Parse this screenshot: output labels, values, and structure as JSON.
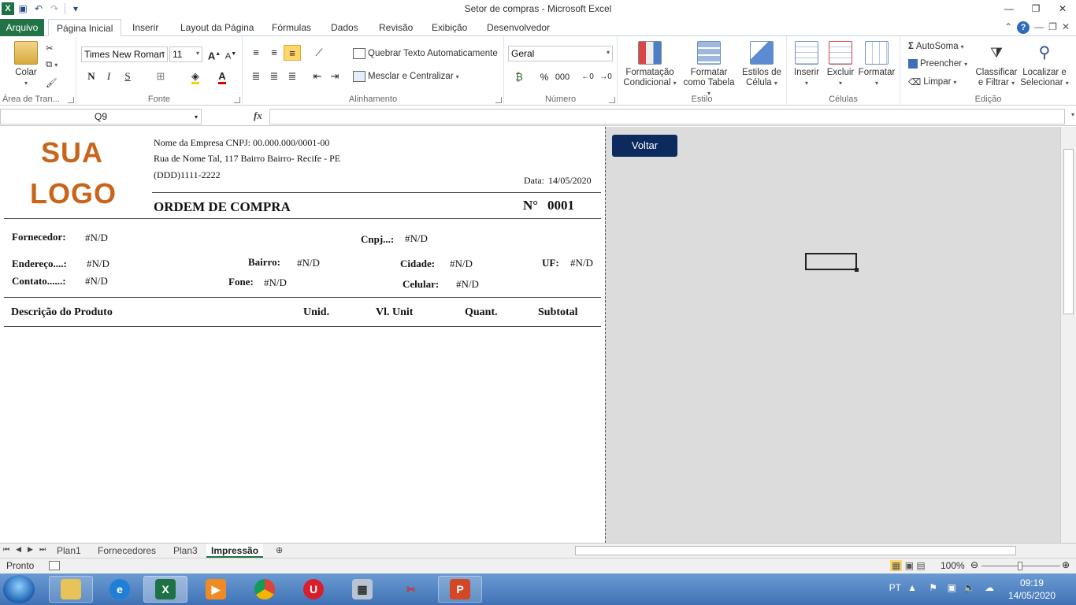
{
  "window": {
    "title": "Setor de compras  -  Microsoft Excel"
  },
  "ribbon_tabs": {
    "file": "Arquivo",
    "items": [
      "Página Inicial",
      "Inserir",
      "Layout da Página",
      "Fórmulas",
      "Dados",
      "Revisão",
      "Exibição",
      "Desenvolvedor"
    ]
  },
  "clipboard": {
    "paste": "Colar",
    "label": "Área de Tran..."
  },
  "font": {
    "name": "Times New Roman",
    "size": "11",
    "bold": "N",
    "italic": "I",
    "underline": "S",
    "label": "Fonte"
  },
  "alignment": {
    "wrap": "Quebrar Texto Automaticamente",
    "merge": "Mesclar e Centralizar",
    "label": "Alinhamento"
  },
  "number": {
    "format": "Geral",
    "percent": "%",
    "thousands": "000",
    "label": "Número"
  },
  "style": {
    "conditional": "Formatação Condicional",
    "as_table": "Formatar como Tabela",
    "cell_styles": "Estilos de Célula",
    "label": "Estilo"
  },
  "cells": {
    "insert": "Inserir",
    "delete": "Excluir",
    "format": "Formatar",
    "label": "Células"
  },
  "editing": {
    "autosum": "AutoSoma",
    "fill": "Preencher",
    "clear": "Limpar",
    "sort": "Classificar e Filtrar",
    "find": "Localizar e Selecionar",
    "label": "Edição"
  },
  "formula_bar": {
    "cell_ref": "Q9",
    "fx": "fx",
    "content": ""
  },
  "sheet": {
    "logo_line1": "SUA",
    "logo_line2": "LOGO",
    "company_line": "Nome da Empresa CNPJ: 00.000.000/0001-00",
    "address_line": "Rua de Nome Tal, 117 Bairro Bairro- Recife  - PE",
    "phone_line": "(DDD)1111-2222",
    "date_label": "Data:",
    "date_value": "14/05/2020",
    "order_title": "ORDEM DE COMPRA",
    "order_no_label": "N°",
    "order_no": "0001",
    "fields": {
      "fornecedor_label": "Fornecedor:",
      "fornecedor": "#N/D",
      "cnpj_label": "Cnpj...:",
      "cnpj": "#N/D",
      "endereco_label": "Endereço....:",
      "endereco": "#N/D",
      "bairro_label": "Bairro:",
      "bairro": "#N/D",
      "cidade_label": "Cidade:",
      "cidade": "#N/D",
      "uf_label": "UF:",
      "uf": "#N/D",
      "contato_label": "Contato......:",
      "contato": "#N/D",
      "fone_label": "Fone:",
      "fone": "#N/D",
      "celular_label": "Celular:",
      "celular": "#N/D"
    },
    "columns": {
      "descricao": "Descrição do Produto",
      "unid": "Unid.",
      "vl_unit": "Vl. Unit",
      "quant": "Quant.",
      "subtotal": "Subtotal"
    },
    "voltar_button": "Voltar"
  },
  "sheet_tabs": [
    "Plan1",
    "Fornecedores",
    "Plan3",
    "Impressão"
  ],
  "active_sheet": "Impressão",
  "status": {
    "text": "Pronto",
    "zoom": "100%"
  },
  "taskbar": {
    "lang": "PT",
    "time": "09:19",
    "date": "14/05/2020"
  },
  "colors": {
    "excel_green": "#217346",
    "logo_orange": "#c8651a",
    "voltar_bg": "#0c2a5e"
  }
}
